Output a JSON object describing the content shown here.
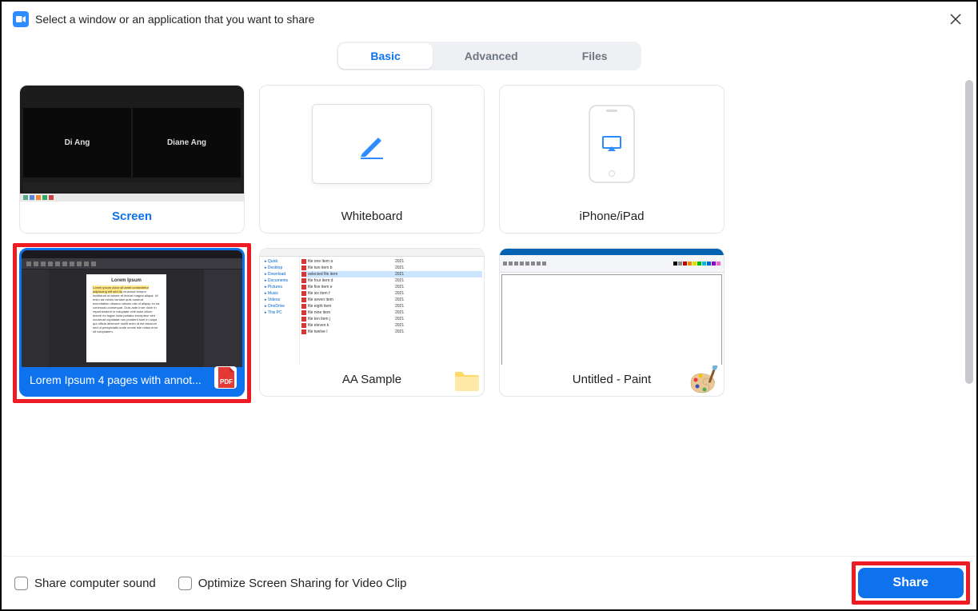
{
  "header": {
    "title": "Select a window or an application that you want to share"
  },
  "tabs": {
    "items": [
      {
        "label": "Basic",
        "active": true
      },
      {
        "label": "Advanced",
        "active": false
      },
      {
        "label": "Files",
        "active": false
      }
    ]
  },
  "options": {
    "screen": {
      "label": "Screen",
      "participants": [
        "Di Ang",
        "Diane Ang"
      ]
    },
    "whiteboard": {
      "label": "Whiteboard"
    },
    "iphone": {
      "label": "iPhone/iPad"
    },
    "pdf": {
      "label": "Lorem Ipsum 4 pages with annot...",
      "doc_title": "Lorem Ipsum",
      "selected": true,
      "icon_label": "PDF"
    },
    "explorer": {
      "label": "AA Sample"
    },
    "paint": {
      "label": "Untitled - Paint"
    }
  },
  "footer": {
    "sound_label": "Share computer sound",
    "optimize_label": "Optimize Screen Sharing for Video Clip",
    "share_label": "Share"
  }
}
